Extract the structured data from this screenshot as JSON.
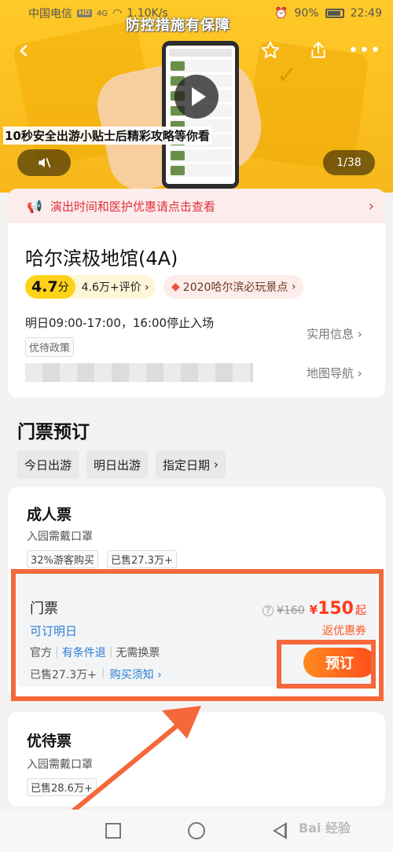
{
  "status_bar": {
    "carrier": "中国电信",
    "hd": "HD",
    "network": "4G",
    "speed": "1.10K/s",
    "battery": "90%",
    "time": "22:49"
  },
  "hero": {
    "caption_top": "防控措施有保障",
    "caption": "10秒安全出游小贴士后精彩攻略等你看",
    "counter": "1/38",
    "icons": [
      "back-icon",
      "star-icon",
      "share-icon",
      "more-icon",
      "play-icon",
      "mute-icon"
    ]
  },
  "notice": {
    "text": "演出时间和医护优惠请点击查看"
  },
  "attraction": {
    "name": "哈尔滨极地馆(4A)",
    "score_value": "4.7",
    "score_unit": "分",
    "reviews": "4.6万+评价",
    "rank": "2020哈尔滨必玩景点",
    "hours": "明日09:00-17:00，16:00停止入场",
    "policy": "优待政策",
    "practical_info": "实用信息",
    "map_nav": "地图导航"
  },
  "tickets": {
    "section_title": "门票预订",
    "date_tabs": [
      "今日出游",
      "明日出游",
      "指定日期"
    ],
    "adult": {
      "title": "成人票",
      "subtitle": "入园需戴口罩",
      "tag1": "32%游客购买",
      "tag2": "已售27.3万+",
      "item": {
        "name": "门票",
        "available": "可订明日",
        "official": "官方",
        "refund": "有条件退",
        "no_exchange": "无需换票",
        "sold": "已售27.3万+",
        "notice": "购买须知",
        "orig_price": "¥160",
        "price_symbol": "¥",
        "price": "150",
        "price_suffix": "起",
        "coupon": "返优惠券",
        "book": "预订"
      }
    },
    "discount": {
      "title": "优待票",
      "subtitle": "入园需戴口罩",
      "tag": "已售28.6万+"
    }
  },
  "watermark": "Bai 经验",
  "colors": {
    "accent": "#ff4d1d",
    "highlight": "#f4683a",
    "link": "#2a7fd4",
    "hero_bg": "#ffc928"
  }
}
